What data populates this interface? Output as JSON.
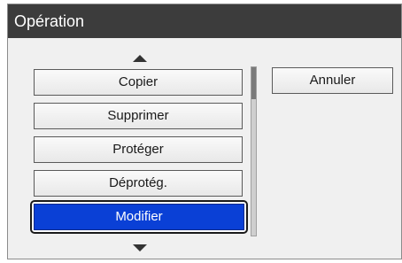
{
  "dialog": {
    "title": "Opération",
    "items": [
      {
        "label": "Copier"
      },
      {
        "label": "Supprimer"
      },
      {
        "label": "Protéger"
      },
      {
        "label": "Déprotég."
      },
      {
        "label": "Modifier"
      }
    ],
    "selected_index": 4,
    "cancel_label": "Annuler"
  },
  "icons": {
    "scroll_up": "triangle-up-icon",
    "scroll_down": "triangle-down-icon"
  },
  "colors": {
    "title_bar": "#3c3c3c",
    "selected_item": "#0a40d6",
    "panel_background": "#f0f0f0"
  }
}
